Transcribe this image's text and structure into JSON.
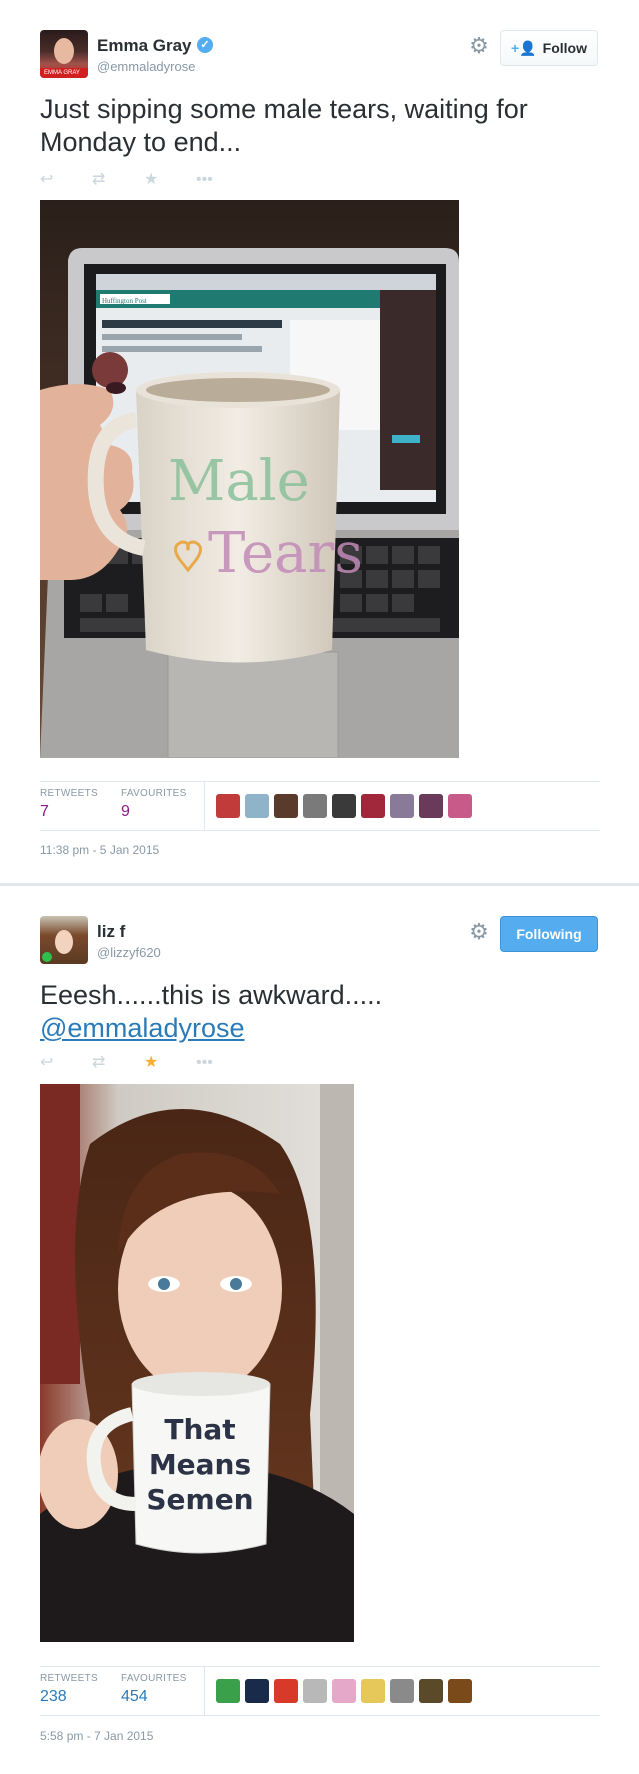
{
  "tweets": [
    {
      "name": "Emma Gray",
      "handle": "@emmaladyrose",
      "avatar_caption": "EMMA GRAY",
      "text": "Just sipping some male tears, waiting for Monday to end...",
      "follow_label": "Follow",
      "mug_text": "Male Tears",
      "site_label": "Huffington Post",
      "stats": {
        "retweets_label": "RETWEETS",
        "retweets": "7",
        "favourites_label": "FAVOURITES",
        "favourites": "9"
      },
      "timestamp": "11:38 pm - 5 Jan 2015",
      "favorited": false
    },
    {
      "name": "liz f",
      "handle": "@lizzyf620",
      "text": "Eeesh......this is awkward.....",
      "mention": "@emmaladyrose",
      "follow_label": "Following",
      "mug_text": [
        "That",
        "Means",
        "Semen"
      ],
      "stats": {
        "retweets_label": "RETWEETS",
        "retweets": "238",
        "favourites_label": "FAVOURITES",
        "favourites": "454"
      },
      "timestamp": "5:58 pm - 7 Jan 2015",
      "favorited": true
    }
  ],
  "icons": {
    "reply": "reply-icon",
    "retweet": "retweet-icon",
    "favorite": "star-icon",
    "more": "more-dots-icon",
    "gear": "gear-icon",
    "verified": "verified-badge-icon"
  },
  "colors": {
    "link": "#2b7bb9",
    "follow_blue": "#55acee",
    "fav_gold": "#ffac33",
    "muted": "#8899a6"
  }
}
